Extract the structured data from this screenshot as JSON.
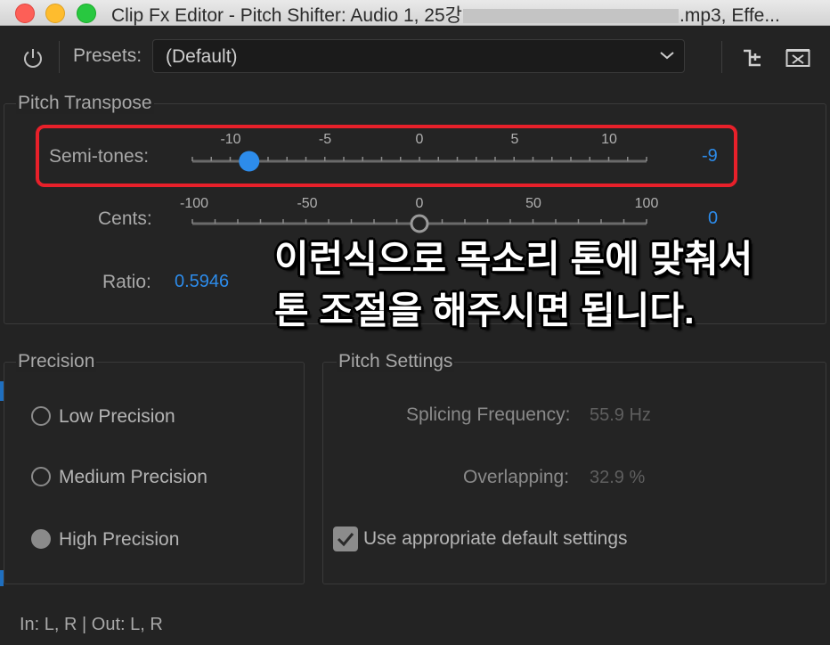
{
  "window": {
    "title_prefix": "Clip Fx Editor - Pitch Shifter: Audio 1, 25강",
    "title_suffix": ".mp3, Effe..."
  },
  "toolbar": {
    "presets_label": "Presets:",
    "preset_value": "(Default)",
    "icons": [
      "power-icon",
      "chevron-down-icon",
      "routing-icon",
      "close-box-icon"
    ]
  },
  "pitch_transpose": {
    "legend": "Pitch Transpose",
    "semitones": {
      "label": "Semi-tones:",
      "ticks": [
        "-10",
        "-5",
        "0",
        "5",
        "10"
      ],
      "value": "-9",
      "range": [
        -12,
        12
      ],
      "slider_value": -9
    },
    "cents": {
      "label": "Cents:",
      "ticks": [
        "-100",
        "-50",
        "0",
        "50",
        "100"
      ],
      "value": "0",
      "range": [
        -100,
        100
      ],
      "slider_value": 0
    },
    "ratio": {
      "label": "Ratio:",
      "value": "0.5946"
    }
  },
  "annotation": {
    "line1": "이런식으로 목소리 톤에 맞춰서",
    "line2": "톤 조절을 해주시면 됩니다."
  },
  "precision": {
    "legend": "Precision",
    "options": [
      {
        "label": "Low Precision",
        "selected": false
      },
      {
        "label": "Medium Precision",
        "selected": false
      },
      {
        "label": "High Precision",
        "selected": true
      }
    ]
  },
  "pitch_settings": {
    "legend": "Pitch Settings",
    "splicing_label": "Splicing Frequency:",
    "splicing_value": "55.9 Hz",
    "overlapping_label": "Overlapping:",
    "overlapping_value": "32.9 %",
    "default_settings_label": "Use appropriate default settings",
    "default_settings_checked": true
  },
  "footer": {
    "io": "In: L, R | Out: L, R"
  },
  "colors": {
    "accent": "#2d8ceb",
    "highlight": "#e8202a",
    "background": "#232323"
  }
}
